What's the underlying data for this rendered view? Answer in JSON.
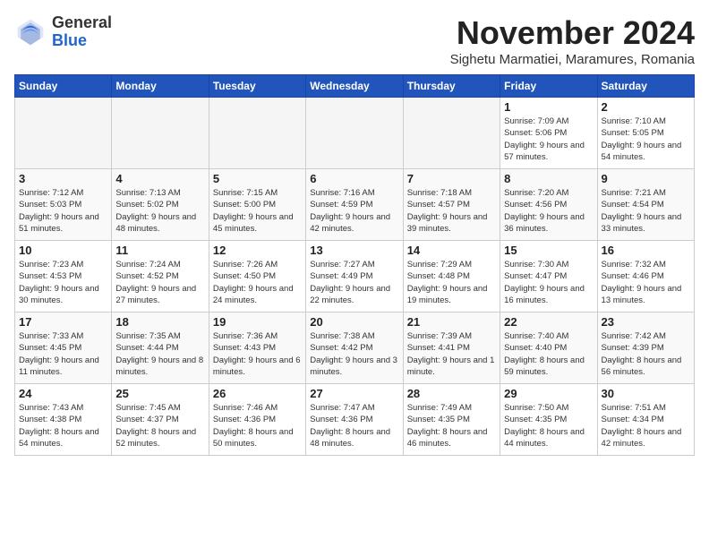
{
  "logo": {
    "general": "General",
    "blue": "Blue"
  },
  "title": "November 2024",
  "location": "Sighetu Marmatiei, Maramures, Romania",
  "days_of_week": [
    "Sunday",
    "Monday",
    "Tuesday",
    "Wednesday",
    "Thursday",
    "Friday",
    "Saturday"
  ],
  "weeks": [
    [
      {
        "day": "",
        "info": ""
      },
      {
        "day": "",
        "info": ""
      },
      {
        "day": "",
        "info": ""
      },
      {
        "day": "",
        "info": ""
      },
      {
        "day": "",
        "info": ""
      },
      {
        "day": "1",
        "info": "Sunrise: 7:09 AM\nSunset: 5:06 PM\nDaylight: 9 hours and 57 minutes."
      },
      {
        "day": "2",
        "info": "Sunrise: 7:10 AM\nSunset: 5:05 PM\nDaylight: 9 hours and 54 minutes."
      }
    ],
    [
      {
        "day": "3",
        "info": "Sunrise: 7:12 AM\nSunset: 5:03 PM\nDaylight: 9 hours and 51 minutes."
      },
      {
        "day": "4",
        "info": "Sunrise: 7:13 AM\nSunset: 5:02 PM\nDaylight: 9 hours and 48 minutes."
      },
      {
        "day": "5",
        "info": "Sunrise: 7:15 AM\nSunset: 5:00 PM\nDaylight: 9 hours and 45 minutes."
      },
      {
        "day": "6",
        "info": "Sunrise: 7:16 AM\nSunset: 4:59 PM\nDaylight: 9 hours and 42 minutes."
      },
      {
        "day": "7",
        "info": "Sunrise: 7:18 AM\nSunset: 4:57 PM\nDaylight: 9 hours and 39 minutes."
      },
      {
        "day": "8",
        "info": "Sunrise: 7:20 AM\nSunset: 4:56 PM\nDaylight: 9 hours and 36 minutes."
      },
      {
        "day": "9",
        "info": "Sunrise: 7:21 AM\nSunset: 4:54 PM\nDaylight: 9 hours and 33 minutes."
      }
    ],
    [
      {
        "day": "10",
        "info": "Sunrise: 7:23 AM\nSunset: 4:53 PM\nDaylight: 9 hours and 30 minutes."
      },
      {
        "day": "11",
        "info": "Sunrise: 7:24 AM\nSunset: 4:52 PM\nDaylight: 9 hours and 27 minutes."
      },
      {
        "day": "12",
        "info": "Sunrise: 7:26 AM\nSunset: 4:50 PM\nDaylight: 9 hours and 24 minutes."
      },
      {
        "day": "13",
        "info": "Sunrise: 7:27 AM\nSunset: 4:49 PM\nDaylight: 9 hours and 22 minutes."
      },
      {
        "day": "14",
        "info": "Sunrise: 7:29 AM\nSunset: 4:48 PM\nDaylight: 9 hours and 19 minutes."
      },
      {
        "day": "15",
        "info": "Sunrise: 7:30 AM\nSunset: 4:47 PM\nDaylight: 9 hours and 16 minutes."
      },
      {
        "day": "16",
        "info": "Sunrise: 7:32 AM\nSunset: 4:46 PM\nDaylight: 9 hours and 13 minutes."
      }
    ],
    [
      {
        "day": "17",
        "info": "Sunrise: 7:33 AM\nSunset: 4:45 PM\nDaylight: 9 hours and 11 minutes."
      },
      {
        "day": "18",
        "info": "Sunrise: 7:35 AM\nSunset: 4:44 PM\nDaylight: 9 hours and 8 minutes."
      },
      {
        "day": "19",
        "info": "Sunrise: 7:36 AM\nSunset: 4:43 PM\nDaylight: 9 hours and 6 minutes."
      },
      {
        "day": "20",
        "info": "Sunrise: 7:38 AM\nSunset: 4:42 PM\nDaylight: 9 hours and 3 minutes."
      },
      {
        "day": "21",
        "info": "Sunrise: 7:39 AM\nSunset: 4:41 PM\nDaylight: 9 hours and 1 minute."
      },
      {
        "day": "22",
        "info": "Sunrise: 7:40 AM\nSunset: 4:40 PM\nDaylight: 8 hours and 59 minutes."
      },
      {
        "day": "23",
        "info": "Sunrise: 7:42 AM\nSunset: 4:39 PM\nDaylight: 8 hours and 56 minutes."
      }
    ],
    [
      {
        "day": "24",
        "info": "Sunrise: 7:43 AM\nSunset: 4:38 PM\nDaylight: 8 hours and 54 minutes."
      },
      {
        "day": "25",
        "info": "Sunrise: 7:45 AM\nSunset: 4:37 PM\nDaylight: 8 hours and 52 minutes."
      },
      {
        "day": "26",
        "info": "Sunrise: 7:46 AM\nSunset: 4:36 PM\nDaylight: 8 hours and 50 minutes."
      },
      {
        "day": "27",
        "info": "Sunrise: 7:47 AM\nSunset: 4:36 PM\nDaylight: 8 hours and 48 minutes."
      },
      {
        "day": "28",
        "info": "Sunrise: 7:49 AM\nSunset: 4:35 PM\nDaylight: 8 hours and 46 minutes."
      },
      {
        "day": "29",
        "info": "Sunrise: 7:50 AM\nSunset: 4:35 PM\nDaylight: 8 hours and 44 minutes."
      },
      {
        "day": "30",
        "info": "Sunrise: 7:51 AM\nSunset: 4:34 PM\nDaylight: 8 hours and 42 minutes."
      }
    ]
  ]
}
